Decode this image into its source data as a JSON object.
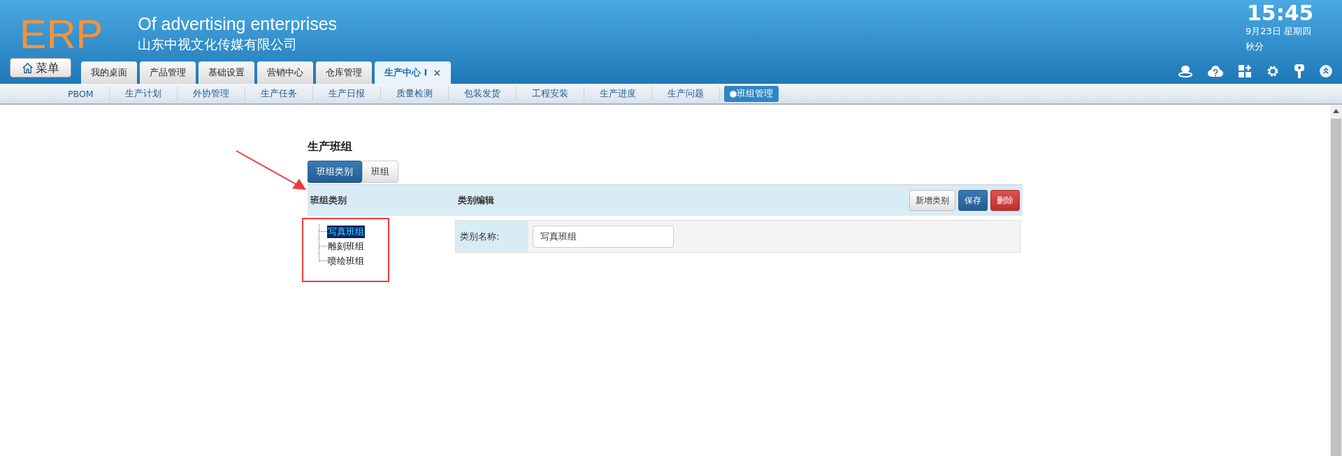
{
  "header": {
    "logo": "ERP",
    "title": "Of advertising enterprises",
    "company": "山东中视文化传媒有限公司",
    "menu_button": "菜单",
    "clock": {
      "time": "15:45",
      "date": "9月23日 星期四",
      "solar_term": "秋分"
    }
  },
  "tabs": [
    {
      "label": "我的桌面",
      "selected": false
    },
    {
      "label": "产品管理",
      "selected": false
    },
    {
      "label": "基础设置",
      "selected": false
    },
    {
      "label": "营销中心",
      "selected": false
    },
    {
      "label": "仓库管理",
      "selected": false
    },
    {
      "label": "生产中心 I",
      "selected": true,
      "close": "×"
    }
  ],
  "subnav": [
    {
      "label": "PBOM",
      "selected": false
    },
    {
      "label": "生产计划",
      "selected": false
    },
    {
      "label": "外协管理",
      "selected": false
    },
    {
      "label": "生产任务",
      "selected": false
    },
    {
      "label": "生产日报",
      "selected": false
    },
    {
      "label": "质量检测",
      "selected": false
    },
    {
      "label": "包装发货",
      "selected": false
    },
    {
      "label": "工程安装",
      "selected": false
    },
    {
      "label": "生产进度",
      "selected": false
    },
    {
      "label": "生产问题",
      "selected": false
    },
    {
      "label": "●班组管理",
      "selected": true
    }
  ],
  "page_title": "生产班组",
  "page_tabs": [
    {
      "label": "班组类别",
      "selected": true
    },
    {
      "label": "班组",
      "selected": false
    }
  ],
  "panel": {
    "left_heading": "班组类别",
    "right_heading": "类别编辑",
    "buttons": [
      {
        "label": "新增类别",
        "kind": "default"
      },
      {
        "label": "保存",
        "kind": "primary"
      },
      {
        "label": "删除",
        "kind": "danger"
      }
    ],
    "tree": [
      {
        "label": "写真班组",
        "selected": true
      },
      {
        "label": "雕刻班组",
        "selected": false
      },
      {
        "label": "喷绘班组",
        "selected": false
      }
    ],
    "form": {
      "label": "类别名称:",
      "value": "写真班组"
    }
  }
}
